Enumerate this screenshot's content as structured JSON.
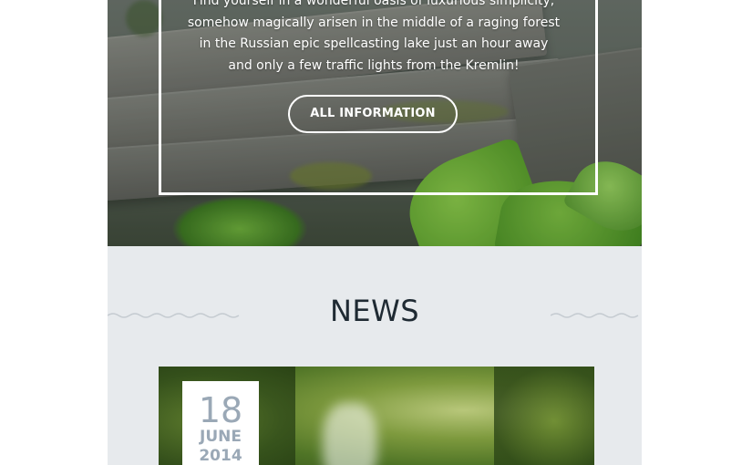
{
  "hero": {
    "intro_text": "Find yourself in a wonderful oasis of luxurious simplicity, somehow magically arisen in the middle of a raging forest in the Russian epic spellcasting lake just an hour away and only a few traffic lights from the Kremlin!",
    "button_label": "ALL INFORMATION"
  },
  "news": {
    "title": "NEWS",
    "card": {
      "date_day": "18",
      "date_month": "JUNE",
      "date_year": "2014"
    }
  },
  "colors": {
    "news_background": "#e7eaed",
    "title_color": "#1f2a33",
    "date_text": "#9aa8b6",
    "frame": "#ffffff"
  }
}
